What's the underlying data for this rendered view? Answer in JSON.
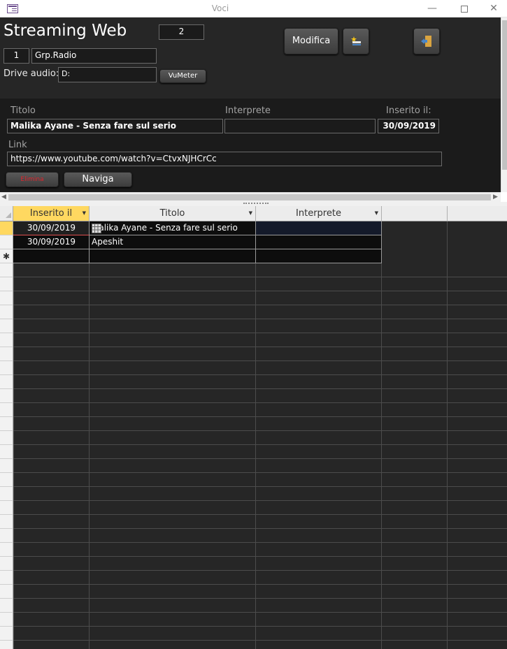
{
  "window": {
    "title": "Voci",
    "minimize": "—",
    "close": "✕"
  },
  "form": {
    "title": "Streaming Web",
    "record_number": "2",
    "group_id": "1",
    "group_name": "Grp.Radio",
    "drive_label": "Drive audio:",
    "drive_value": "D:",
    "vumeter_button": "VuMeter",
    "modifica_button": "Modifica",
    "titolo_label": "Titolo",
    "interprete_label": "Interprete",
    "inserito_label": "Inserito il:",
    "titolo_value": "Malika Ayane - Senza fare sul serio",
    "interprete_value": "",
    "inserito_value": "30/09/2019",
    "link_label": "Link",
    "link_value": "https://www.youtube.com/watch?v=CtvxNJHCrCc",
    "elimina_button": "Elimina",
    "naviga_button": "Naviga",
    "colors": {
      "accent_selected": "#ffd860",
      "elimina_text": "#e0242c"
    }
  },
  "datasheet": {
    "columns": [
      "Inserito il",
      "Titolo",
      "Interprete"
    ],
    "rows": [
      {
        "inserito": "30/09/2019",
        "titolo": "Malika Ayane - Senza fare sul serio",
        "interprete": ""
      },
      {
        "inserito": "30/09/2019",
        "titolo": "Apeshit",
        "interprete": ""
      }
    ],
    "new_row_marker": "✱"
  }
}
